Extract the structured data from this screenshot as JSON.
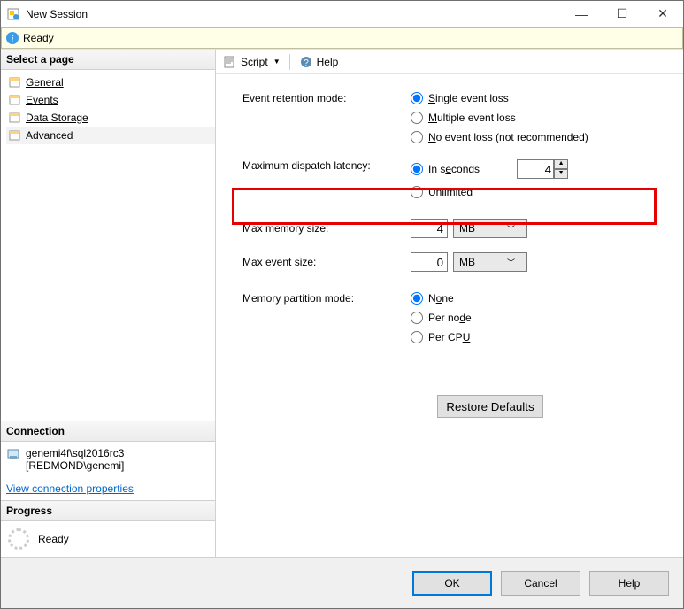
{
  "window": {
    "title": "New Session"
  },
  "readybar": {
    "text": "Ready"
  },
  "sidebar": {
    "select_page_header": "Select a page",
    "pages": [
      {
        "label": "General",
        "selected": false
      },
      {
        "label": "Events",
        "selected": false
      },
      {
        "label": "Data Storage",
        "selected": false
      },
      {
        "label": "Advanced",
        "selected": true
      }
    ],
    "connection_header": "Connection",
    "connection_server": "genemi4f\\sql2016rc3",
    "connection_user": "[REDMOND\\genemi]",
    "view_conn_link": "View connection properties",
    "progress_header": "Progress",
    "progress_text": "Ready"
  },
  "toolbar": {
    "script_label": "Script",
    "help_label": "Help"
  },
  "form": {
    "event_retention_label": "Event retention mode:",
    "retention_single": "Single event loss",
    "retention_multiple": "Multiple event loss",
    "retention_none": "No event loss (not recommended)",
    "max_dispatch_label": "Maximum dispatch latency:",
    "dispatch_seconds": "In seconds",
    "dispatch_seconds_value": "4",
    "dispatch_unlimited": "Unlimited",
    "max_memory_label": "Max memory size:",
    "max_memory_value": "4",
    "max_memory_unit": "MB",
    "max_event_label": "Max event size:",
    "max_event_value": "0",
    "max_event_unit": "MB",
    "mem_partition_label": "Memory partition mode:",
    "partition_none": "None",
    "partition_per_node": "Per node",
    "partition_per_cpu": "Per CPU",
    "restore_defaults": "Restore Defaults"
  },
  "footer": {
    "ok": "OK",
    "cancel": "Cancel",
    "help": "Help"
  }
}
